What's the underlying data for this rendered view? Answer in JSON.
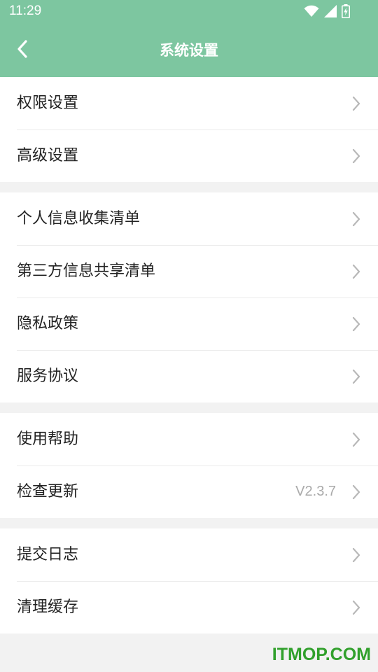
{
  "status_bar": {
    "time": "11:29",
    "icons": [
      "wifi-icon",
      "signal-icon",
      "battery-charging-icon"
    ]
  },
  "header": {
    "title": "系统设置",
    "back_icon": "chevron-left-icon"
  },
  "groups": [
    {
      "items": [
        {
          "label": "权限设置"
        },
        {
          "label": "高级设置"
        }
      ]
    },
    {
      "items": [
        {
          "label": "个人信息收集清单"
        },
        {
          "label": "第三方信息共享清单"
        },
        {
          "label": "隐私政策"
        },
        {
          "label": "服务协议"
        }
      ]
    },
    {
      "items": [
        {
          "label": "使用帮助"
        },
        {
          "label": "检查更新",
          "value": "V2.3.7"
        }
      ]
    },
    {
      "items": [
        {
          "label": "提交日志"
        },
        {
          "label": "清理缓存"
        }
      ]
    }
  ],
  "watermark": "ITMOP.COM",
  "colors": {
    "header_bg": "#7dc6a0",
    "page_bg": "#f2f2f2",
    "row_bg": "#ffffff",
    "watermark": "#31a02c"
  }
}
